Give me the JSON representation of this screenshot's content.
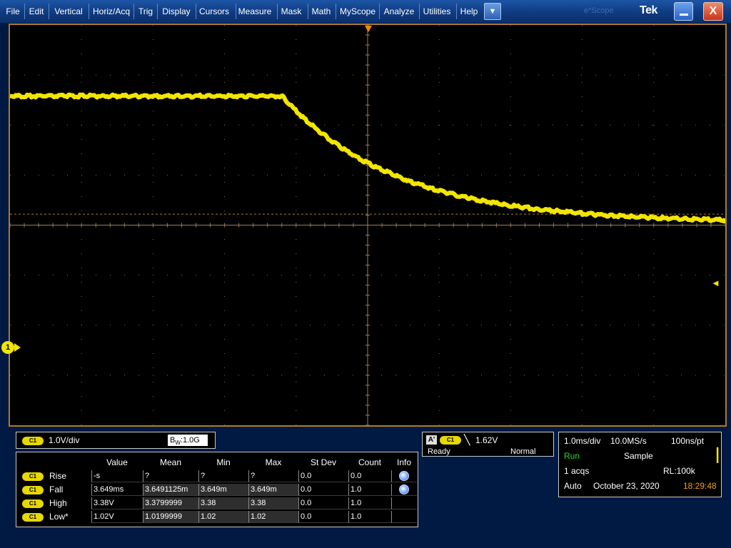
{
  "menu": {
    "items": [
      "File",
      "Edit",
      "Vertical",
      "Horiz/Acq",
      "Trig",
      "Display",
      "Cursors",
      "Measure",
      "Mask",
      "Math",
      "MyScope",
      "Analyze",
      "Utilities",
      "Help"
    ],
    "dropdown_glyph": "▼",
    "ghost_text": "e*Scope",
    "brand": "Tek",
    "close_glyph": "X"
  },
  "display": {
    "channel_marker": "1",
    "trigger_level_glyph": "◄",
    "colors": {
      "trace": "#f2e600",
      "grid": "#8a6a4a",
      "frame": "#b07a2a",
      "trigger_marker": "#f08a00"
    }
  },
  "waveform": {
    "channel": "C1",
    "description_of_shape_only": "",
    "high_level_v": 3.38,
    "low_level_v": 1.02,
    "fall_time_ms": 3.649,
    "fall_start_div": 4.4,
    "volts_per_div": 1.0,
    "time_per_div_ms": 1.0,
    "offset_div": -1.0
  },
  "vertical": {
    "channel_badge": "C1",
    "volts_div": "1.0V/div",
    "bw_prefix": "B",
    "bw_sub": "W",
    "bw_value": ":1.0G"
  },
  "measurements": {
    "headers": [
      "Value",
      "Mean",
      "Min",
      "Max",
      "St Dev",
      "Count",
      "Info"
    ],
    "rows": [
      {
        "badge": "C1",
        "label": "Rise",
        "value": "-s",
        "mean": "?",
        "min": "?",
        "max": "?",
        "stdev": "0.0",
        "count": "0.0",
        "info": "warning-icon"
      },
      {
        "badge": "C1",
        "label": "Fall",
        "value": "3.649ms",
        "mean": "3.6491125m",
        "min": "3.649m",
        "max": "3.649m",
        "stdev": "0.0",
        "count": "1.0",
        "info": "info-icon"
      },
      {
        "badge": "C1",
        "label": "High",
        "value": "3.38V",
        "mean": "3.3799999",
        "min": "3.38",
        "max": "3.38",
        "stdev": "0.0",
        "count": "1.0",
        "info": ""
      },
      {
        "badge": "C1",
        "label": "Low*",
        "value": "1.02V",
        "mean": "1.0199999",
        "min": "1.02",
        "max": "1.02",
        "stdev": "0.0",
        "count": "1.0",
        "info": ""
      }
    ]
  },
  "trigger": {
    "a_badge": "A'",
    "channel_badge": "C1",
    "slope_glyph": "╲",
    "level": "1.62V",
    "state": "Ready",
    "mode": "Normal"
  },
  "horizontal": {
    "time_div": "1.0ms/div",
    "sample_rate": "10.0MS/s",
    "resolution": "100ns/pt",
    "run_state": "Run",
    "acq_mode": "Sample",
    "acqs": "1 acqs",
    "record_length": "RL:100k",
    "trigger_mode": "Auto",
    "date": "October 23, 2020",
    "time": "18:29:48",
    "colors": {
      "run": "#22dd22",
      "time": "#f0a020"
    }
  }
}
